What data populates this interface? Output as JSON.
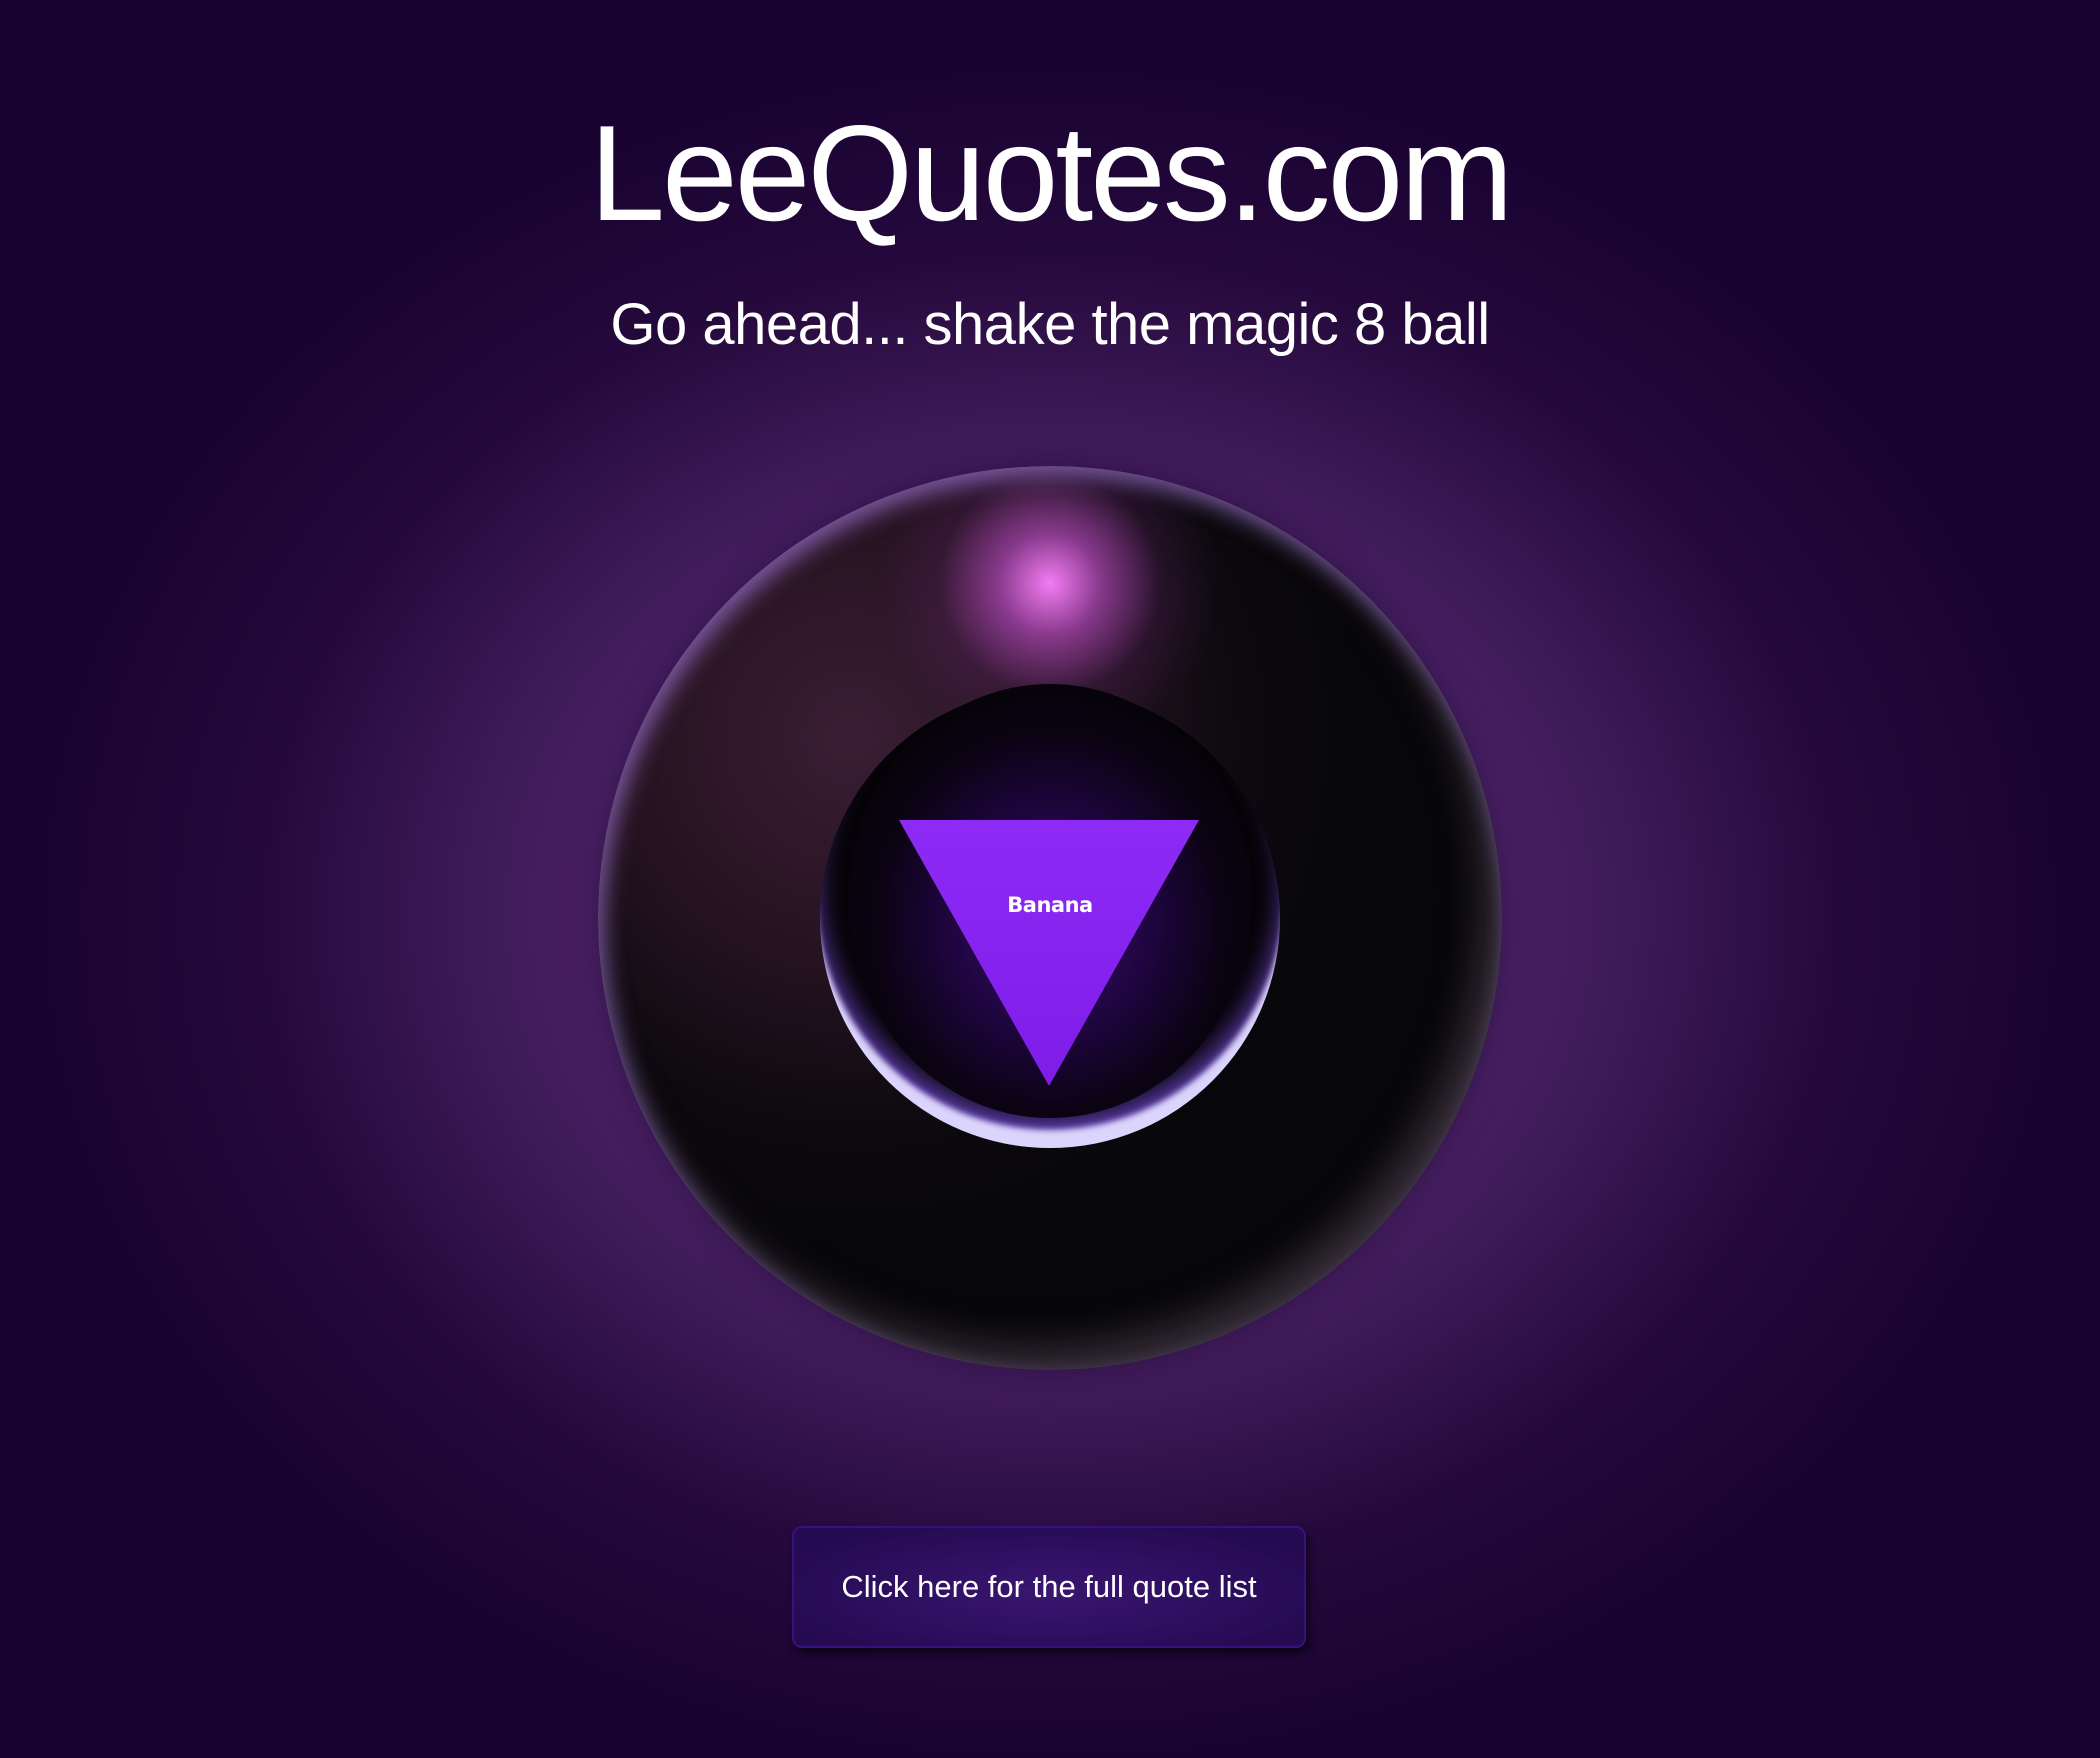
{
  "header": {
    "title": "LeeQuotes.com",
    "subtitle": "Go ahead... shake the magic 8 ball"
  },
  "magic_ball": {
    "answer": "Banana"
  },
  "cta": {
    "label": "Click here for the full quote list"
  },
  "colors": {
    "background": "#5e2a78",
    "triangle": "#8a22f2",
    "button": "#2c0e5e",
    "highlight": "#ff7dff"
  }
}
